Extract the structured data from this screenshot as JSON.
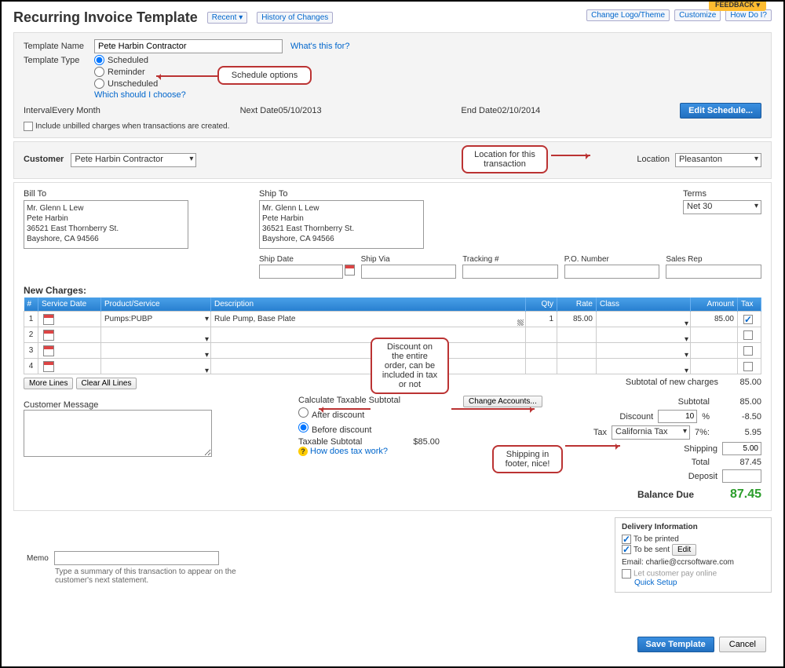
{
  "page_title": "Recurring Invoice Template",
  "header_buttons": {
    "recent": "Recent ▾",
    "history": "History of Changes",
    "change_logo": "Change Logo/Theme",
    "customize": "Customize",
    "how_do_i": "How Do I?"
  },
  "feedback_tab": "FEEDBACK ▾",
  "template_name_label": "Template Name",
  "template_name_value": "Pete Harbin Contractor",
  "whats_this": "What's this for?",
  "template_type_label": "Template Type",
  "type_options": {
    "scheduled": "Scheduled",
    "reminder": "Reminder",
    "unscheduled": "Unscheduled"
  },
  "which_should_i_choose": "Which should I choose?",
  "interval": {
    "label": "Interval",
    "value": "Every Month",
    "next_date_label": "Next Date",
    "next_date": "05/10/2013",
    "end_date_label": "End Date",
    "end_date": "02/10/2014"
  },
  "edit_schedule_btn": "Edit Schedule...",
  "include_unbilled": "Include unbilled charges when transactions are created.",
  "customer_label": "Customer",
  "customer_value": "Pete Harbin Contractor",
  "location_label": "Location",
  "location_value": "Pleasanton",
  "bill_to_label": "Bill To",
  "bill_to": "Mr. Glenn L Lew\nPete Harbin\n36521 East Thornberry St.\nBayshore, CA  94566",
  "ship_to_label": "Ship To",
  "ship_to": "Mr. Glenn L Lew\nPete Harbin\n36521 East Thornberry St.\nBayshore, CA  94566",
  "terms_label": "Terms",
  "terms_value": "Net 30",
  "ship_fields": {
    "ship_date": "Ship Date",
    "ship_via": "Ship Via",
    "tracking": "Tracking #",
    "po": "P.O. Number",
    "sales_rep": "Sales Rep"
  },
  "new_charges_label": "New Charges:",
  "table_headers": {
    "num": "#",
    "service_date": "Service Date",
    "product": "Product/Service",
    "description": "Description",
    "qty": "Qty",
    "rate": "Rate",
    "class": "Class",
    "amount": "Amount",
    "tax": "Tax"
  },
  "line_items": [
    {
      "num": "1",
      "product": "Pumps:PUBP",
      "description": "Rule Pump, Base Plate",
      "qty": "1",
      "rate": "85.00",
      "amount": "85.00",
      "tax_checked": true
    },
    {
      "num": "2"
    },
    {
      "num": "3"
    },
    {
      "num": "4"
    }
  ],
  "more_lines": "More Lines",
  "clear_all": "Clear All Lines",
  "subtotal_new_charges_label": "Subtotal of new charges",
  "subtotal_new_charges": "85.00",
  "change_accounts": "Change Accounts...",
  "customer_message_label": "Customer Message",
  "calc_taxable_label": "Calculate Taxable Subtotal",
  "after_discount": "After discount",
  "before_discount": "Before discount",
  "taxable_subtotal_label": "Taxable Subtotal",
  "taxable_subtotal": "$85.00",
  "how_does_tax": "How does tax work?",
  "totals": {
    "subtotal_label": "Subtotal",
    "subtotal": "85.00",
    "discount_label": "Discount",
    "discount_pct": "10",
    "discount_val": "-8.50",
    "tax_label": "Tax",
    "tax_name": "California Tax",
    "tax_pct": "7%:",
    "tax_val": "5.95",
    "shipping_label": "Shipping",
    "shipping_val": "5.00",
    "total_label": "Total",
    "total": "87.45",
    "deposit_label": "Deposit",
    "balance_label": "Balance Due",
    "balance": "87.45"
  },
  "memo_label": "Memo",
  "memo_hint": "Type a summary of this transaction to appear on the customer's next statement.",
  "delivery": {
    "title": "Delivery Information",
    "to_print": "To be printed",
    "to_sent": "To be sent",
    "edit": "Edit",
    "email_label": "Email:",
    "email": "charlie@ccrsoftware.com",
    "let_pay": "Let customer pay online",
    "quick_setup": "Quick Setup"
  },
  "save_btn": "Save Template",
  "cancel_btn": "Cancel",
  "callouts": {
    "schedule": "Schedule options",
    "location": "Location for this\ntransaction",
    "discount": "Discount on\nthe entire\norder, can be\nincluded in tax\nor not",
    "shipping": "Shipping in\nfooter, nice!"
  }
}
